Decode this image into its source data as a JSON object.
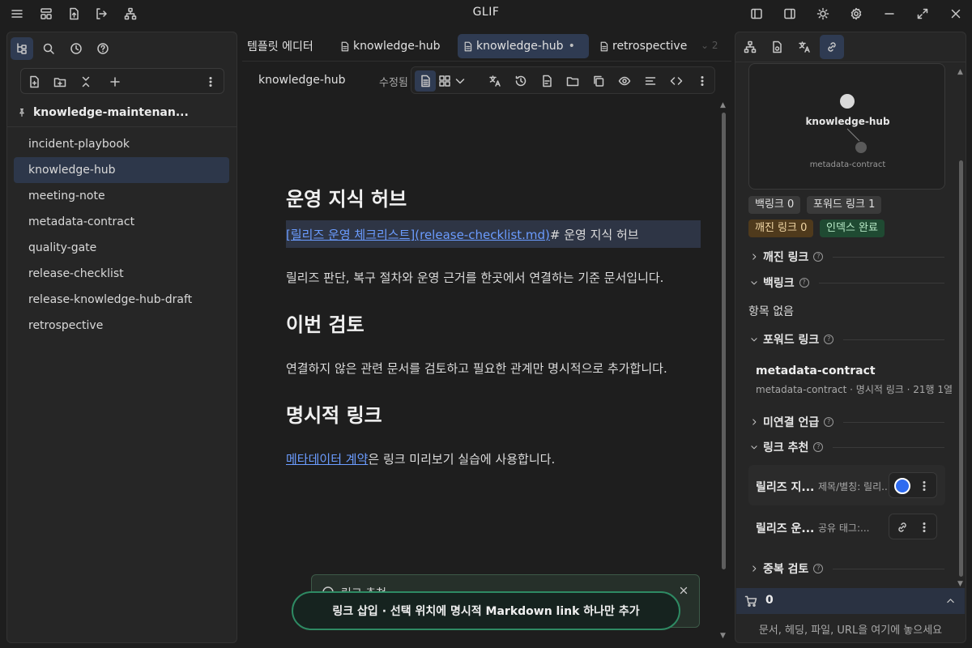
{
  "app": {
    "title": "GLIF"
  },
  "left_panel": {
    "vault_name": "knowledge-maintenan...",
    "files": [
      "incident-playbook",
      "knowledge-hub",
      "meeting-note",
      "metadata-contract",
      "quality-gate",
      "release-checklist",
      "release-knowledge-hub-draft",
      "retrospective"
    ],
    "active_file": "knowledge-hub"
  },
  "tabs": [
    {
      "label": "템플릿 에디터",
      "icon": "",
      "dirty": ""
    },
    {
      "label": "knowledge-hub",
      "icon": "file-icon",
      "dirty": ""
    },
    {
      "label": "knowledge-hub",
      "icon": "file-icon",
      "dirty": "•"
    },
    {
      "label": "retrospective",
      "icon": "file-icon",
      "dirty": ""
    }
  ],
  "tab_overflow": "2",
  "editor": {
    "file_name": "knowledge-hub",
    "status": "수정됨",
    "heading1": "운영 지식 허브",
    "link_line": {
      "bracket_text": "[릴리즈 운영 체크리스트]",
      "url_text": "(release-checklist.md)",
      "trailing": "# 운영 지식 허브"
    },
    "para1": "릴리즈 판단, 복구 절차와 운영 근거를 한곳에서 연결하는 기준 문서입니다.",
    "heading2": "이번 검토",
    "para2": "연결하지 않은 관련 문서를 검토하고 필요한 관계만 명시적으로 추가합니다.",
    "heading3": "명시적 링크",
    "para3_link": "메타데이터 계약",
    "para3_rest": "은 링크 미리보기 실습에 사용합니다."
  },
  "notice": {
    "title": "링크 추천",
    "toast": "링크 삽입 · 선택 위치에 명시적 Markdown link 하나만 추가"
  },
  "right_panel": {
    "graph": {
      "node_main": "knowledge-hub",
      "node_linked": "metadata-contract"
    },
    "chips": {
      "backlinks": "백링크 0",
      "forward_links": "포워드 링크 1",
      "broken_links": "깨진 링크 0",
      "index": "인덱스 완료"
    },
    "sections": {
      "broken": "깨진 링크",
      "backlinks": "백링크",
      "forward": "포워드 링크",
      "unlinked": "미연결 언급",
      "suggestions": "링크 추천",
      "duplicates": "중복 검토"
    },
    "no_items": "항목 없음",
    "forward_item": {
      "title": "metadata-contract",
      "meta": "metadata-contract · 명시적 링크 · 21행 1열"
    },
    "suggestions": [
      {
        "title": "릴리즈 지...",
        "sub": "제목/별칭: 릴리..."
      },
      {
        "title": "릴리즈 운...",
        "sub": "공유 태그:..."
      }
    ],
    "cart_count": "0",
    "drop_hint": "문서, 헤딩, 파일, URL을 여기에 놓으세요"
  },
  "colors": {
    "accent": "#2f3b52",
    "link": "#6b9cff",
    "toast_border": "#2e8a63",
    "orange_chip": "#4f3a1c",
    "green_chip": "#1f4a32"
  }
}
